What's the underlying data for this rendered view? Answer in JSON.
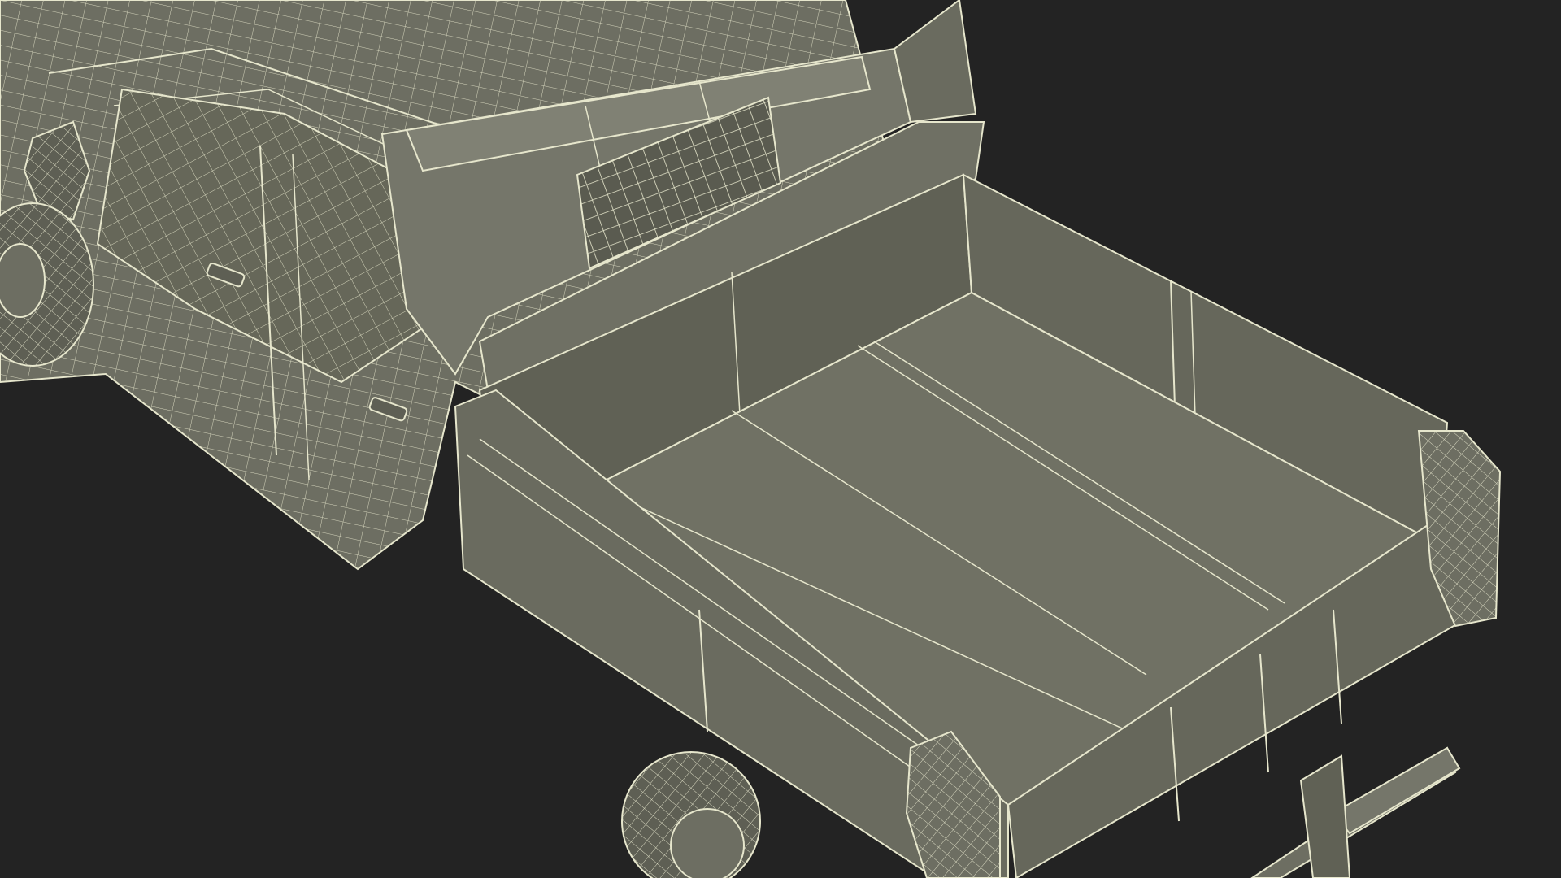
{
  "scene": {
    "subject": "dump-truck-wireframe-render",
    "colors": {
      "background": "#232323",
      "surface": "#6d6e62",
      "surface_dark": "#5e5f54",
      "surface_light": "#7b7c70",
      "wire": "#e6e6cc"
    }
  }
}
